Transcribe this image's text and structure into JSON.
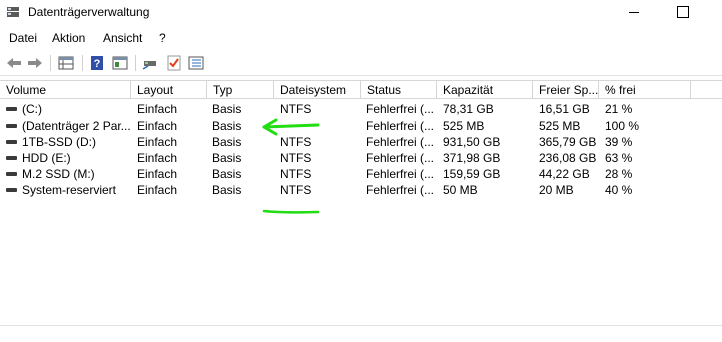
{
  "window": {
    "title": "Datenträgerverwaltung",
    "icon": "disk-management-icon"
  },
  "menu": [
    {
      "label": "Datei"
    },
    {
      "label": "Aktion"
    },
    {
      "label": "Ansicht"
    },
    {
      "label": "?"
    }
  ],
  "toolbar": {
    "buttons": [
      {
        "icon": "back-arrow-icon"
      },
      {
        "icon": "forward-arrow-icon"
      },
      {
        "icon": "properties-grid-icon"
      },
      {
        "icon": "help-icon"
      },
      {
        "icon": "pane-icon"
      },
      {
        "icon": "connect-drive-icon"
      },
      {
        "icon": "check-document-icon"
      },
      {
        "icon": "list-view-icon"
      }
    ]
  },
  "table": {
    "columns": [
      "Volume",
      "Layout",
      "Typ",
      "Dateisystem",
      "Status",
      "Kapazität",
      "Freier Sp...",
      "% frei"
    ],
    "rows": [
      {
        "volume": "(C:)",
        "layout": "Einfach",
        "typ": "Basis",
        "dateisystem": "NTFS",
        "status": "Fehlerfrei (...",
        "kapazitaet": "78,31 GB",
        "frei": "16,51 GB",
        "prozent": "21 %"
      },
      {
        "volume": "(Datenträger 2 Par...",
        "layout": "Einfach",
        "typ": "Basis",
        "dateisystem": "",
        "status": "Fehlerfrei (...",
        "kapazitaet": "525 MB",
        "frei": "525 MB",
        "prozent": "100 %"
      },
      {
        "volume": "1TB-SSD (D:)",
        "layout": "Einfach",
        "typ": "Basis",
        "dateisystem": "NTFS",
        "status": "Fehlerfrei (...",
        "kapazitaet": "931,50 GB",
        "frei": "365,79 GB",
        "prozent": "39 %"
      },
      {
        "volume": "HDD (E:)",
        "layout": "Einfach",
        "typ": "Basis",
        "dateisystem": "NTFS",
        "status": "Fehlerfrei (...",
        "kapazitaet": "371,98 GB",
        "frei": "236,08 GB",
        "prozent": "63 %"
      },
      {
        "volume": "M.2 SSD (M:)",
        "layout": "Einfach",
        "typ": "Basis",
        "dateisystem": "NTFS",
        "status": "Fehlerfrei (...",
        "kapazitaet": "159,59 GB",
        "frei": "44,22 GB",
        "prozent": "28 %"
      },
      {
        "volume": "System-reserviert",
        "layout": "Einfach",
        "typ": "Basis",
        "dateisystem": "NTFS",
        "status": "Fehlerfrei (...",
        "kapazitaet": "50 MB",
        "frei": "20 MB",
        "prozent": "40 %"
      }
    ]
  },
  "annotations": {
    "arrow_color": "#22dd11",
    "underline_color": "#22dd11"
  }
}
